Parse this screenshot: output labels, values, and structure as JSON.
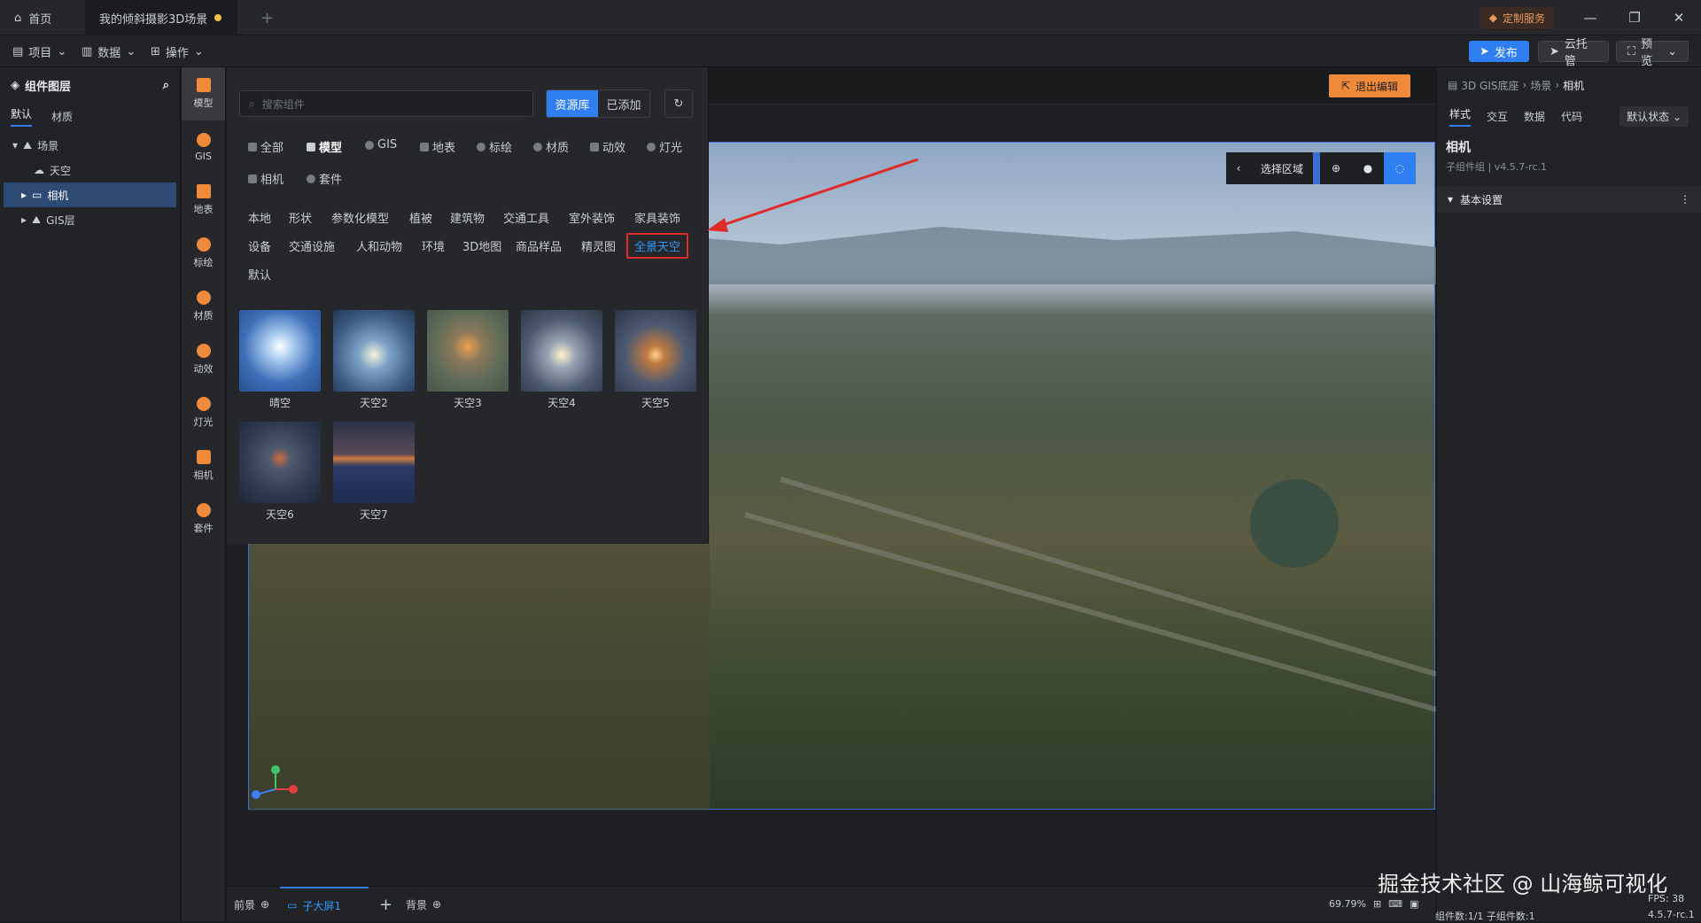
{
  "titlebar": {
    "home_tab": "首页",
    "scene_tab": "我的倾斜摄影3D场景",
    "custom_service": "定制服务"
  },
  "menubar": {
    "project": "项目",
    "data": "数据",
    "operate": "操作",
    "publish": "发布",
    "cloud": "云托管",
    "preview": "预览"
  },
  "layers": {
    "title": "组件图层",
    "tabs": [
      "默认",
      "材质"
    ],
    "items": [
      "场景",
      "天空",
      "相机",
      "GIS层"
    ]
  },
  "iconbar": [
    "模型",
    "GIS",
    "地表",
    "标绘",
    "材质",
    "动效",
    "灯光",
    "相机",
    "套件"
  ],
  "assets": {
    "search_placeholder": "搜索组件",
    "library": "资源库",
    "added": "已添加",
    "categories": [
      "全部",
      "模型",
      "GIS",
      "地表",
      "标绘",
      "材质",
      "动效",
      "灯光",
      "相机",
      "套件"
    ],
    "subcategories": [
      "本地",
      "形状",
      "参数化模型",
      "植被",
      "建筑物",
      "交通工具",
      "室外装饰",
      "家具装饰",
      "设备",
      "交通设施",
      "人和动物",
      "环境",
      "3D地图",
      "商品样品",
      "精灵图",
      "全景天空",
      "默认"
    ],
    "thumbs": [
      "晴空",
      "天空2",
      "天空3",
      "天空4",
      "天空5",
      "天空6",
      "天空7"
    ]
  },
  "viewport": {
    "exit_edit": "退出编辑",
    "select_area": "选择区域"
  },
  "rpanel": {
    "breadcrumb": [
      "3D GIS底座",
      "场景",
      "相机"
    ],
    "tabs": [
      "样式",
      "交互",
      "数据",
      "代码"
    ],
    "state": "默认状态",
    "title": "相机",
    "subtitle": "子组件组 | v4.5.7-rc.1",
    "section": "基本设置"
  },
  "bottombar": {
    "front": "前景",
    "subscreen": "子大屏1",
    "back": "背景",
    "zoom": "69.79%",
    "counts": "组件数:1/1  子组件数:1",
    "fps": "FPS: 38",
    "version": "4.5.7-rc.1"
  },
  "watermark": "掘金技术社区 @ 山海鲸可视化",
  "colors": {
    "accent": "#2f7ff2",
    "orange": "#ef8a3a",
    "highlight": "#e02b2b"
  }
}
